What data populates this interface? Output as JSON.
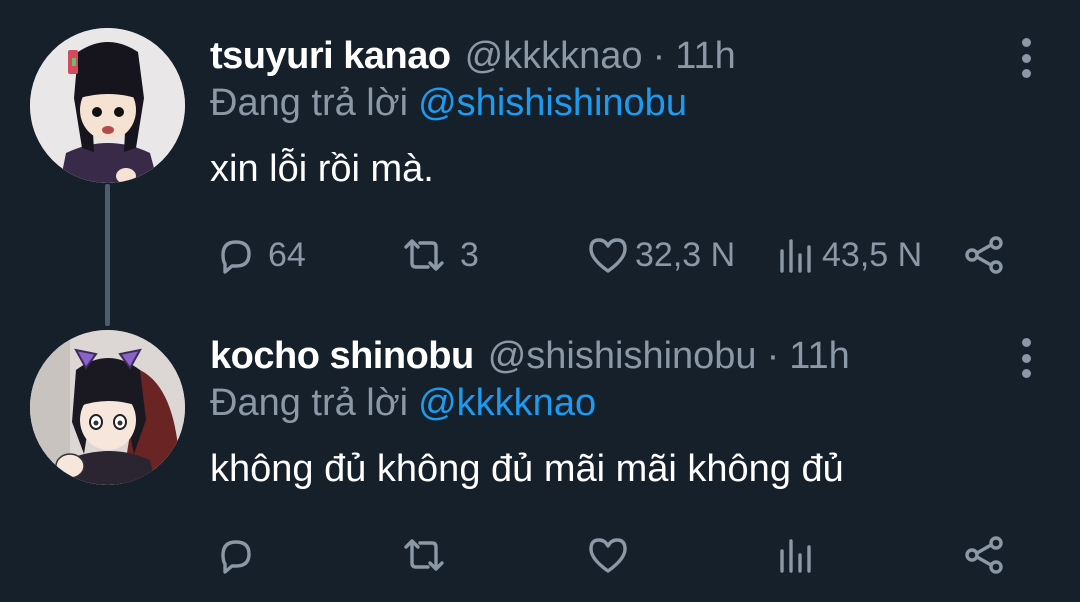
{
  "tweets": [
    {
      "author_name": "tsuyuri kanao",
      "handle": "@kkkknao",
      "separator": "·",
      "time": "11h",
      "reply_prefix": "Đang trả lời",
      "reply_to": "@shishishinobu",
      "text": "xin lỗi rồi mà.",
      "stats": {
        "replies": "64",
        "retweets": "3",
        "likes": "32,3 N",
        "views": "43,5 N"
      },
      "avatar": "kanao-avatar",
      "colors": {
        "avatar_bg": "#e9e7e8"
      }
    },
    {
      "author_name": "kocho shinobu",
      "handle": "@shishishinobu",
      "separator": "·",
      "time": "11h",
      "reply_prefix": "Đang trả lời",
      "reply_to": "@kkkknao",
      "text": "không đủ không đủ mãi mãi không đủ",
      "stats": {
        "replies": "",
        "retweets": "",
        "likes": "",
        "views": ""
      },
      "avatar": "shinobu-avatar",
      "colors": {
        "avatar_bg": "#dcd7d4"
      }
    }
  ],
  "icons": {
    "reply": "reply-icon",
    "retweet": "retweet-icon",
    "like": "heart-icon",
    "views": "views-icon",
    "share": "share-icon",
    "menu": "more-options-icon"
  },
  "colors": {
    "background": "#15202b",
    "primary_text": "#ffffff",
    "secondary_text": "#8b98a5",
    "accent": "#1d9bf0",
    "thread_line": "#4d5d6c"
  }
}
